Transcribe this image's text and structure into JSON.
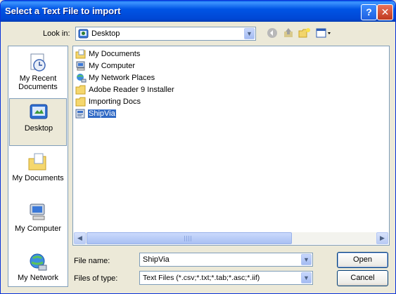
{
  "window": {
    "title": "Select a Text File to import",
    "help_glyph": "?",
    "close_glyph": "✕"
  },
  "lookin": {
    "label": "Look in:",
    "value": "Desktop"
  },
  "toolbar": {
    "back_icon": "back-icon",
    "up_icon": "up-folder-icon",
    "new_folder_icon": "new-folder-icon",
    "views_icon": "views-menu-icon"
  },
  "places": [
    {
      "label": "My Recent\nDocuments",
      "icon": "recent-documents-icon"
    },
    {
      "label": "Desktop",
      "icon": "desktop-icon",
      "selected": true
    },
    {
      "label": "My Documents",
      "icon": "my-documents-icon"
    },
    {
      "label": "My Computer",
      "icon": "my-computer-icon"
    },
    {
      "label": "My Network",
      "icon": "my-network-icon"
    }
  ],
  "files": [
    {
      "name": "My Documents",
      "icon": "my-documents-icon"
    },
    {
      "name": "My Computer",
      "icon": "my-computer-icon"
    },
    {
      "name": "My Network Places",
      "icon": "network-places-icon"
    },
    {
      "name": "Adobe Reader 9 Installer",
      "icon": "folder-icon"
    },
    {
      "name": "Importing Docs",
      "icon": "folder-icon"
    },
    {
      "name": "ShipVia",
      "icon": "text-file-icon",
      "selected": true
    }
  ],
  "filename": {
    "label": "File name:",
    "value": "ShipVia"
  },
  "filetype": {
    "label": "Files of type:",
    "value": "Text Files (*.csv;*.txt;*.tab;*.asc;*.iif)"
  },
  "buttons": {
    "open": "Open",
    "cancel": "Cancel"
  },
  "colors": {
    "title_blue": "#0055E5",
    "selection": "#316AC5",
    "dialog_bg": "#ECE9D8"
  }
}
